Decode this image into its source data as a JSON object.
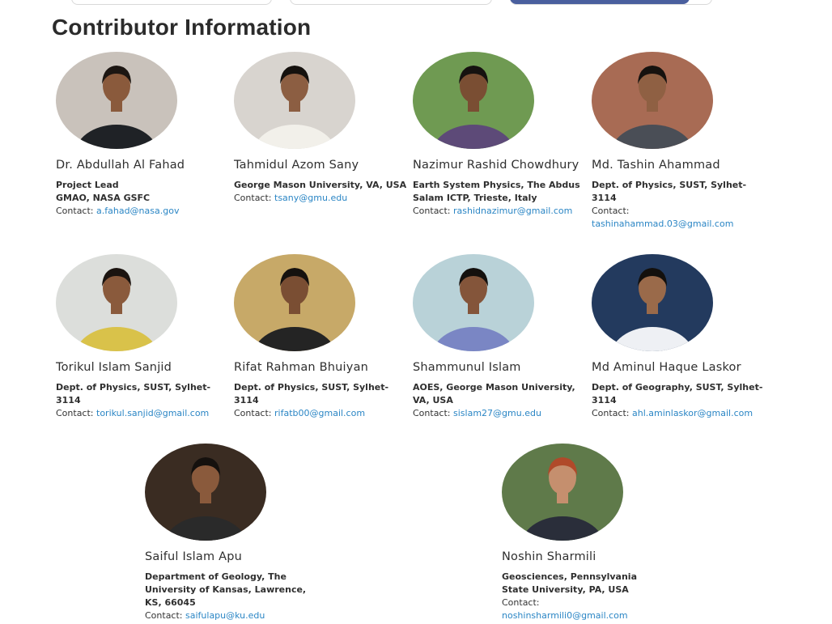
{
  "page": {
    "title": "Contributor Information"
  },
  "contributors": [
    {
      "name": "Dr. Abdullah Al Fahad",
      "affiliation": "Project Lead\nGMAO, NASA GSFC",
      "contact_label": "Contact:",
      "email": "a.fahad@nasa.gov",
      "photo_colors": {
        "bg": "#c9c2bb",
        "skin": "#8a5a3c",
        "hair": "#1c1612",
        "shirt": "#1f2226"
      }
    },
    {
      "name": "Tahmidul Azom Sany",
      "affiliation": "George Mason University, VA, USA",
      "contact_label": "Contact:",
      "email": "tsany@gmu.edu",
      "photo_colors": {
        "bg": "#d8d4cf",
        "skin": "#8c5e42",
        "hair": "#15110e",
        "shirt": "#f2f0ea"
      }
    },
    {
      "name": "Nazimur Rashid Chowdhury",
      "affiliation": "Earth System Physics, The Abdus Salam ICTP, Trieste, Italy",
      "contact_label": "Contact:",
      "email": "rashidnazimur@gmail.com",
      "photo_colors": {
        "bg": "#6f9a52",
        "skin": "#7a4e33",
        "hair": "#161210",
        "shirt": "#5d4a78"
      }
    },
    {
      "name": "Md. Tashin Ahammad",
      "affiliation": "Dept. of Physics, SUST, Sylhet-3114",
      "contact_label": "Contact:",
      "email": "tashinahammad.03@gmail.com",
      "photo_colors": {
        "bg": "#a86b54",
        "skin": "#8f6043",
        "hair": "#16120f",
        "shirt": "#4a4e56"
      }
    },
    {
      "name": "Torikul Islam Sanjid",
      "affiliation": "Dept. of Physics, SUST, Sylhet-3114",
      "contact_label": "Contact:",
      "email": "torikul.sanjid@gmail.com",
      "photo_colors": {
        "bg": "#dcdedb",
        "skin": "#8a5a3c",
        "hair": "#1b1410",
        "shirt": "#d9c24a"
      }
    },
    {
      "name": "Rifat Rahman Bhuiyan",
      "affiliation": "Dept. of Physics, SUST, Sylhet-3114",
      "contact_label": "Contact:",
      "email": "rifatb00@gmail.com",
      "photo_colors": {
        "bg": "#c7a968",
        "skin": "#7a4e33",
        "hair": "#15110e",
        "shirt": "#242424"
      }
    },
    {
      "name": "Shammunul Islam",
      "affiliation": "AOES, George Mason University, VA, USA",
      "contact_label": "Contact:",
      "email": "sislam27@gmu.edu",
      "photo_colors": {
        "bg": "#b9d2d8",
        "skin": "#84553a",
        "hair": "#14100d",
        "shirt": "#7a86c4"
      }
    },
    {
      "name": "Md Aminul Haque Laskor",
      "affiliation": "Dept. of Geography, SUST, Sylhet-3114",
      "contact_label": "Contact:",
      "email": "ahl.aminlaskor@gmail.com",
      "photo_colors": {
        "bg": "#233a5e",
        "skin": "#9a6a4a",
        "hair": "#13100d",
        "shirt": "#eef0f4"
      }
    },
    {
      "name": "Saiful Islam Apu",
      "affiliation": "Department of Geology, The University of Kansas, Lawrence, KS, 66045",
      "contact_label": "Contact:",
      "email": "saifulapu@ku.edu",
      "photo_colors": {
        "bg": "#3a2c22",
        "skin": "#8a5a3c",
        "hair": "#15110e",
        "shirt": "#2a2a2a"
      }
    },
    {
      "name": "Noshin Sharmili",
      "affiliation": "Geosciences, Pennsylvania State University, PA, USA",
      "contact_label": "Contact:",
      "email": "noshinsharmili0@gmail.com",
      "photo_colors": {
        "bg": "#5f7a4a",
        "skin": "#c58f6e",
        "hair": "#b04a2a",
        "shirt": "#2a2e3a"
      }
    }
  ]
}
